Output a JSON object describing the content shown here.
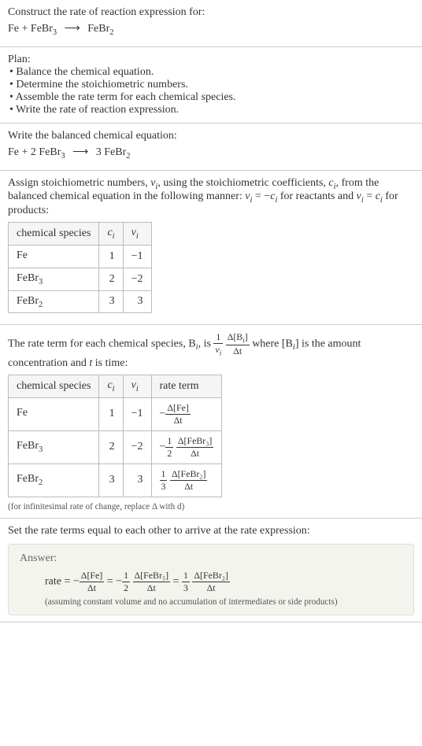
{
  "header": {
    "title": "Construct the rate of reaction expression for:",
    "equation_lhs1": "Fe",
    "equation_plus1": " + ",
    "equation_lhs2": "FeBr",
    "equation_lhs2_sub": "3",
    "arrow": "⟶",
    "equation_rhs": "FeBr",
    "equation_rhs_sub": "2"
  },
  "plan": {
    "title": "Plan:",
    "items": [
      "• Balance the chemical equation.",
      "• Determine the stoichiometric numbers.",
      "• Assemble the rate term for each chemical species.",
      "• Write the rate of reaction expression."
    ]
  },
  "balanced": {
    "title": "Write the balanced chemical equation:",
    "lhs1": "Fe",
    "plus": " + ",
    "coef2": "2 ",
    "lhs2": "FeBr",
    "lhs2_sub": "3",
    "arrow": "⟶",
    "coef_rhs": "3 ",
    "rhs": "FeBr",
    "rhs_sub": "2"
  },
  "assign": {
    "text1": "Assign stoichiometric numbers, ",
    "nu": "ν",
    "i": "i",
    "text2": ", using the stoichiometric coefficients, ",
    "c": "c",
    "text3": ", from the balanced chemical equation in the following manner: ",
    "eq1_lhs": "ν",
    "eq1_eq": " = −",
    "eq1_rhs": "c",
    "text4": " for reactants and ",
    "eq2_lhs": "ν",
    "eq2_eq": " = ",
    "eq2_rhs": "c",
    "text5": " for products:",
    "table_headers": {
      "species": "chemical species",
      "ci": "c",
      "nui": "ν"
    },
    "rows": [
      {
        "species": "Fe",
        "sub": "",
        "ci": "1",
        "nui": "−1"
      },
      {
        "species": "FeBr",
        "sub": "3",
        "ci": "2",
        "nui": "−2"
      },
      {
        "species": "FeBr",
        "sub": "2",
        "ci": "3",
        "nui": "3"
      }
    ]
  },
  "rate_term": {
    "text1": "The rate term for each chemical species, B",
    "text2": ", is ",
    "frac1_top": "1",
    "frac1_bot_sym": "ν",
    "frac2_top": "Δ[B",
    "frac2_top_close": "]",
    "frac2_bot": "Δt",
    "text3": " where [B",
    "text4": "] is the amount concentration and ",
    "t": "t",
    "text5": " is time:",
    "table_headers": {
      "species": "chemical species",
      "ci": "c",
      "nui": "ν",
      "rate": "rate term"
    },
    "rows": [
      {
        "species": "Fe",
        "sub": "",
        "ci": "1",
        "nui": "−1",
        "sign": "−",
        "coef_top": "",
        "coef_bot": "",
        "conc": "Δ[Fe]",
        "dt": "Δt"
      },
      {
        "species": "FeBr",
        "sub": "3",
        "ci": "2",
        "nui": "−2",
        "sign": "−",
        "coef_top": "1",
        "coef_bot": "2",
        "conc": "Δ[FeBr₃]",
        "dt": "Δt"
      },
      {
        "species": "FeBr",
        "sub": "2",
        "ci": "3",
        "nui": "3",
        "sign": "",
        "coef_top": "1",
        "coef_bot": "3",
        "conc": "Δ[FeBr₂]",
        "dt": "Δt"
      }
    ],
    "note": "(for infinitesimal rate of change, replace Δ with d)"
  },
  "final": {
    "title": "Set the rate terms equal to each other to arrive at the rate expression:",
    "answer_label": "Answer:",
    "rate_word": "rate",
    "eq": " = ",
    "neg": "−",
    "t1_top": "Δ[Fe]",
    "t1_bot": "Δt",
    "t2_ctop": "1",
    "t2_cbot": "2",
    "t2_top": "Δ[FeBr₃]",
    "t2_bot": "Δt",
    "t3_ctop": "1",
    "t3_cbot": "3",
    "t3_top": "Δ[FeBr₂]",
    "t3_bot": "Δt",
    "note": "(assuming constant volume and no accumulation of intermediates or side products)"
  },
  "chart_data": {
    "type": "table",
    "title": "Stoichiometric numbers and rate terms",
    "species": [
      "Fe",
      "FeBr3",
      "FeBr2"
    ],
    "c_i": [
      1,
      2,
      3
    ],
    "nu_i": [
      -1,
      -2,
      3
    ],
    "rate_terms": [
      "-Δ[Fe]/Δt",
      "-(1/2) Δ[FeBr3]/Δt",
      "(1/3) Δ[FeBr2]/Δt"
    ],
    "rate_expression": "rate = -Δ[Fe]/Δt = -(1/2) Δ[FeBr3]/Δt = (1/3) Δ[FeBr2]/Δt"
  }
}
